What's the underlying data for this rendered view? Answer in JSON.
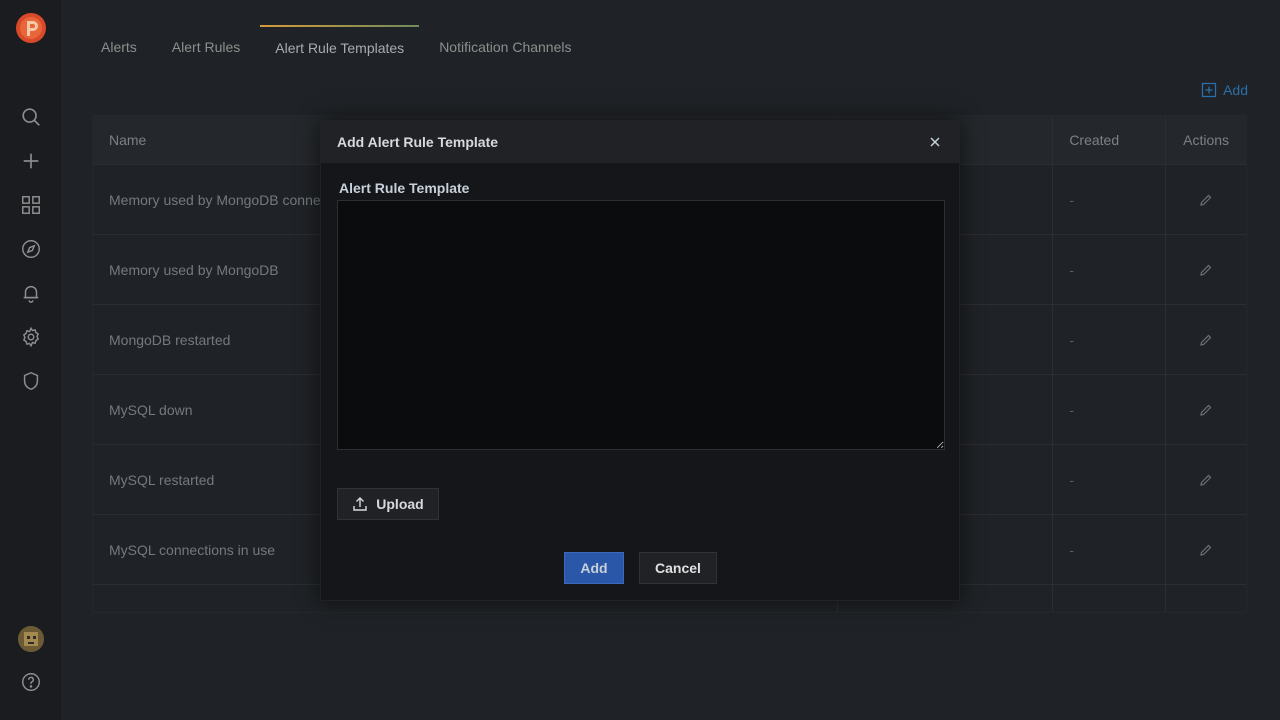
{
  "sidebar": {
    "logo_icon": "percona-logo",
    "items": [
      {
        "icon": "search-icon"
      },
      {
        "icon": "plus-icon"
      },
      {
        "icon": "dashboards-grid-icon"
      },
      {
        "icon": "explore-compass-icon"
      },
      {
        "icon": "bell-icon"
      },
      {
        "icon": "gear-icon"
      },
      {
        "icon": "shield-icon"
      }
    ],
    "help_icon": "help-icon"
  },
  "tabs": [
    {
      "label": "Alerts"
    },
    {
      "label": "Alert Rules"
    },
    {
      "label": "Alert Rule Templates",
      "active": true
    },
    {
      "label": "Notification Channels"
    }
  ],
  "toolbar": {
    "add_label": "Add"
  },
  "table": {
    "headers": {
      "name": "Name",
      "created": "Created",
      "actions": "Actions"
    },
    "rows": [
      {
        "name": "Memory used by MongoDB conne",
        "created": "-"
      },
      {
        "name": "Memory used by MongoDB",
        "created": "-"
      },
      {
        "name": "MongoDB restarted",
        "created": "-"
      },
      {
        "name": "MySQL down",
        "created": "-"
      },
      {
        "name": "MySQL restarted",
        "created": "-"
      },
      {
        "name": "MySQL connections in use",
        "created": "-"
      }
    ]
  },
  "modal": {
    "title": "Add Alert Rule Template",
    "field_label": "Alert Rule Template",
    "textarea_value": "",
    "upload_label": "Upload",
    "add_label": "Add",
    "cancel_label": "Cancel"
  },
  "colors": {
    "accent_primary": "#2b57a8",
    "tab_active_gradient_start": "#d89a39",
    "link_blue": "#2c6fa8"
  }
}
